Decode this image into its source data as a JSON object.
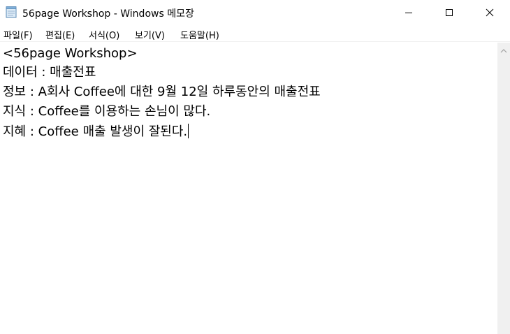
{
  "window": {
    "title": "56page Workshop - Windows 메모장"
  },
  "menu": {
    "items": [
      {
        "label": "파일(F)"
      },
      {
        "label": "편집(E)"
      },
      {
        "label": "서식(O)"
      },
      {
        "label": "보기(V)"
      },
      {
        "label": "도움말(H)"
      }
    ]
  },
  "editor": {
    "lines": [
      "<56page Workshop>",
      "데이터 : 매출전표",
      "정보 : A회사 Coffee에 대한 9월 12일 하루동안의 매출전표",
      "지식 : Coffee를 이용하는 손님이 많다.",
      "지혜 : Coffee 매출 발생이 잘된다."
    ]
  },
  "icons": {
    "app": "notepad-icon",
    "minimize": "minimize-icon",
    "maximize": "maximize-icon",
    "close": "close-icon",
    "scroll_up": "chevron-up-icon"
  },
  "colors": {
    "text": "#000000",
    "background": "#ffffff",
    "scrollbar_track": "#f0f0f0"
  }
}
